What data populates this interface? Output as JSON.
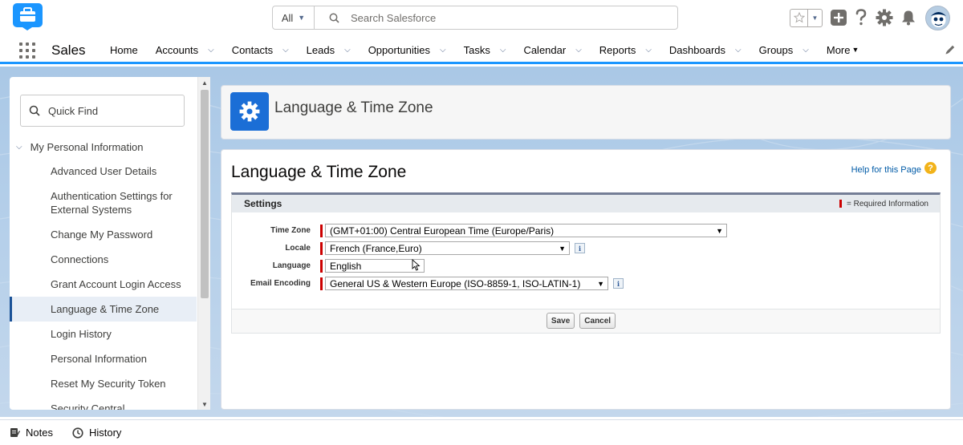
{
  "header": {
    "search_scope": "All",
    "search_placeholder": "Search Salesforce"
  },
  "nav": {
    "app_name": "Sales",
    "items": [
      {
        "label": "Home",
        "has_menu": false
      },
      {
        "label": "Accounts",
        "has_menu": true
      },
      {
        "label": "Contacts",
        "has_menu": true
      },
      {
        "label": "Leads",
        "has_menu": true
      },
      {
        "label": "Opportunities",
        "has_menu": true
      },
      {
        "label": "Tasks",
        "has_menu": true
      },
      {
        "label": "Calendar",
        "has_menu": true
      },
      {
        "label": "Reports",
        "has_menu": true
      },
      {
        "label": "Dashboards",
        "has_menu": true
      },
      {
        "label": "Groups",
        "has_menu": true
      }
    ],
    "more_label": "More"
  },
  "sidebar": {
    "quickfind_placeholder": "Quick Find",
    "section_label": "My Personal Information",
    "items": [
      "Advanced User Details",
      "Authentication Settings for External Systems",
      "Change My Password",
      "Connections",
      "Grant Account Login Access",
      "Language & Time Zone",
      "Login History",
      "Personal Information",
      "Reset My Security Token",
      "Security Central"
    ],
    "active_index": 5
  },
  "page_header": {
    "title": "Language & Time Zone"
  },
  "main": {
    "title": "Language & Time Zone",
    "help_link": "Help for this Page",
    "settings_title": "Settings",
    "required_info": "= Required Information",
    "fields": [
      {
        "label": "Time Zone",
        "value": "(GMT+01:00) Central European Time (Europe/Paris)",
        "has_info": false
      },
      {
        "label": "Locale",
        "value": "French (France,Euro)",
        "has_info": true
      },
      {
        "label": "Language",
        "value": "English",
        "has_info": false
      },
      {
        "label": "Email Encoding",
        "value": "General US & Western Europe (ISO-8859-1, ISO-LATIN-1)",
        "has_info": true
      }
    ],
    "save_label": "Save",
    "cancel_label": "Cancel"
  },
  "utility": {
    "notes_label": "Notes",
    "history_label": "History"
  },
  "colors": {
    "brand_blue": "#1b96ff",
    "header_icon_bg": "#1b6ed6",
    "required_red": "#c00",
    "link": "#015ba7"
  }
}
